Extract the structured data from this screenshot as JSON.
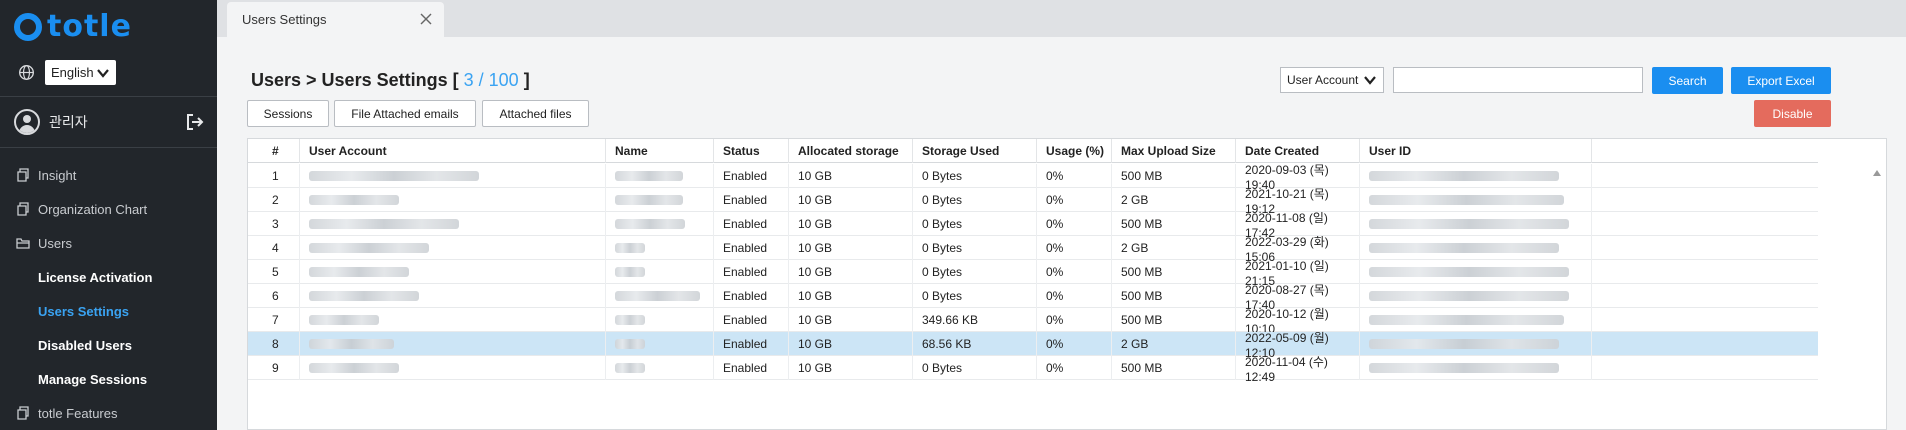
{
  "app": {
    "logo_text": "totle",
    "brand_color": "#1a8ef0",
    "accent_color": "#3aa3f2"
  },
  "sidebar": {
    "language": "English",
    "user_name": "관리자",
    "nav": [
      {
        "label": "Insight",
        "type": "top",
        "icon": "document-icon"
      },
      {
        "label": "Organization Chart",
        "type": "top",
        "icon": "document-icon"
      },
      {
        "label": "Users",
        "type": "top",
        "icon": "folder-icon"
      },
      {
        "label": "License Activation",
        "type": "sub"
      },
      {
        "label": "Users Settings",
        "type": "sub",
        "active": true
      },
      {
        "label": "Disabled Users",
        "type": "sub"
      },
      {
        "label": "Manage Sessions",
        "type": "sub"
      },
      {
        "label": "totle Features",
        "type": "top",
        "icon": "document-icon"
      }
    ]
  },
  "tabs": [
    {
      "label": "Users Settings"
    }
  ],
  "header": {
    "breadcrumb": "Users > Users Settings",
    "count_open": "[",
    "count": "3 / 100",
    "count_close": "]"
  },
  "toolbar": {
    "sessions": "Sessions",
    "file_attached": "File Attached emails",
    "attached_files": "Attached files",
    "search_field": "User Account",
    "search_placeholder": "",
    "search_btn": "Search",
    "export_btn": "Export Excel",
    "disable_btn": "Disable"
  },
  "table": {
    "columns": [
      "#",
      "User Account",
      "Name",
      "Status",
      "Allocated storage",
      "Storage Used",
      "Usage (%)",
      "Max Upload Size",
      "Date Created",
      "User ID"
    ],
    "rows": [
      {
        "num": "1",
        "status": "Enabled",
        "alloc": "10 GB",
        "used": "0 Bytes",
        "usage": "0%",
        "max": "500 MB",
        "date": "2020-09-03 (목) 19:40"
      },
      {
        "num": "2",
        "status": "Enabled",
        "alloc": "10 GB",
        "used": "0 Bytes",
        "usage": "0%",
        "max": "2 GB",
        "date": "2021-10-21 (목) 19:12"
      },
      {
        "num": "3",
        "status": "Enabled",
        "alloc": "10 GB",
        "used": "0 Bytes",
        "usage": "0%",
        "max": "500 MB",
        "date": "2020-11-08 (일) 17:42"
      },
      {
        "num": "4",
        "status": "Enabled",
        "alloc": "10 GB",
        "used": "0 Bytes",
        "usage": "0%",
        "max": "2 GB",
        "date": "2022-03-29 (화) 15:06"
      },
      {
        "num": "5",
        "status": "Enabled",
        "alloc": "10 GB",
        "used": "0 Bytes",
        "usage": "0%",
        "max": "500 MB",
        "date": "2021-01-10 (일) 21:15"
      },
      {
        "num": "6",
        "status": "Enabled",
        "alloc": "10 GB",
        "used": "0 Bytes",
        "usage": "0%",
        "max": "500 MB",
        "date": "2020-08-27 (목) 17:40"
      },
      {
        "num": "7",
        "status": "Enabled",
        "alloc": "10 GB",
        "used": "349.66 KB",
        "usage": "0%",
        "max": "500 MB",
        "date": "2020-10-12 (월) 10:10"
      },
      {
        "num": "8",
        "status": "Enabled",
        "alloc": "10 GB",
        "used": "68.56 KB",
        "usage": "0%",
        "max": "2 GB",
        "date": "2022-05-09 (월) 12:10",
        "selected": true
      },
      {
        "num": "9",
        "status": "Enabled",
        "alloc": "10 GB",
        "used": "0 Bytes",
        "usage": "0%",
        "max": "500 MB",
        "date": "2020-11-04 (수) 12:49"
      }
    ]
  }
}
